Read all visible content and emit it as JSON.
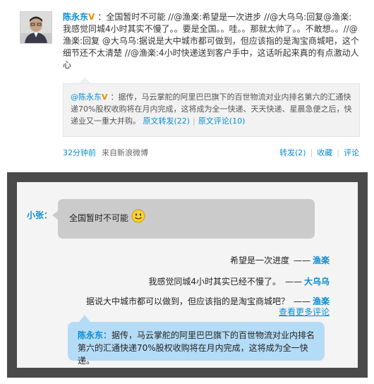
{
  "post": {
    "author": "陈永东",
    "verified_mark": "V",
    "content_after_author": "：全国暂时不可能 //@渔楽:希望是一次进步 //@大乌乌:回复@渔楽:我感觉同城4小时其实不慢了。。要是全国。。哇。。那就太帅了。。不敢想。。//@渔楽:回复 @大乌乌:据说是大中城市都可做到，但应该指的是淘宝商城吧，这个细节还不太清楚 //@渔楽:4小时快递送到客户手中，这话听起来真的有点激动人心",
    "quote": {
      "author": "@陈永东",
      "verified_mark": "V",
      "text": "：据传，马云掌舵的阿里巴巴旗下的百世物流对业内排名第六的汇通快递70%股权收购将在月内完成，这将成为全一快递、天天快递、星晨急便之后，快递业又一重大并购。",
      "repost_link": "原文转发(22)",
      "separator": "|",
      "comment_link": "原文评论(10)"
    },
    "footer": {
      "time": "32分钟前",
      "source": "来自新浪微博",
      "repost": "转发(2)",
      "favorite": "收藏",
      "comment": "评论",
      "separator": "|"
    }
  },
  "mockup": {
    "speaker": "小张：",
    "bubble_text": "全国暂时不可能",
    "replies": [
      {
        "text": "希望是一次进度",
        "dash": "——",
        "name": "渔楽"
      },
      {
        "text": "我感觉同城4小时其实已经不慢了。",
        "dash": "——",
        "name": "大乌乌"
      },
      {
        "text": "据说大中城市都可以做到，但应该指的是淘宝商城吧？",
        "dash": "——",
        "name": "渔楽"
      }
    ],
    "more_link": "查看更多评论",
    "quote_author": "陈永东：",
    "quote_text": "据传，马云掌舵的阿里巴巴旗下的百世物流对业内排名第六的汇通快递70%股权收购将在月内完成，这将成为全一快递。"
  },
  "colors": {
    "link_blue": "#0a8cd2",
    "verified_orange": "#f08a00",
    "frame_dark": "#4a4a4a",
    "bubble_gray": "#cbcbcb",
    "quote_blue": "#b5dcf7"
  }
}
